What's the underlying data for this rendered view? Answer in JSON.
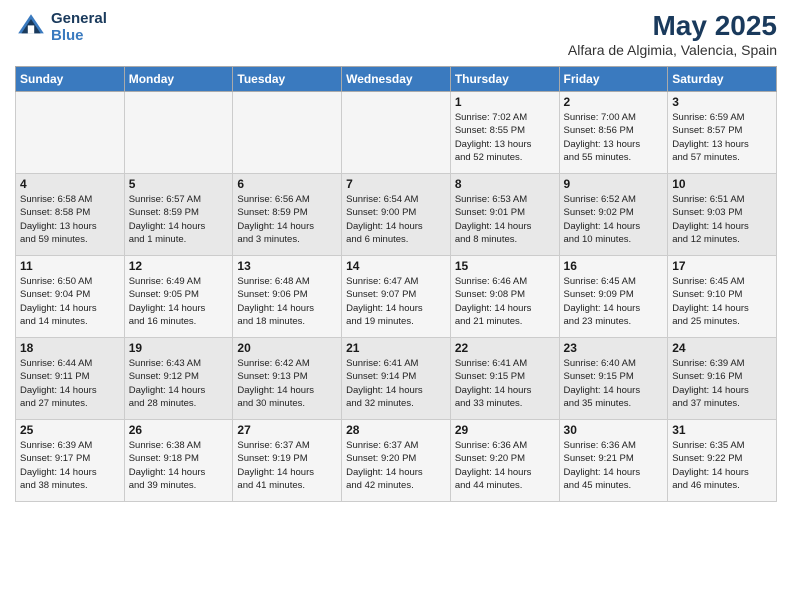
{
  "logo": {
    "line1": "General",
    "line2": "Blue"
  },
  "title": "May 2025",
  "subtitle": "Alfara de Algimia, Valencia, Spain",
  "headers": [
    "Sunday",
    "Monday",
    "Tuesday",
    "Wednesday",
    "Thursday",
    "Friday",
    "Saturday"
  ],
  "rows": [
    [
      {
        "day": "",
        "info": ""
      },
      {
        "day": "",
        "info": ""
      },
      {
        "day": "",
        "info": ""
      },
      {
        "day": "",
        "info": ""
      },
      {
        "day": "1",
        "info": "Sunrise: 7:02 AM\nSunset: 8:55 PM\nDaylight: 13 hours\nand 52 minutes."
      },
      {
        "day": "2",
        "info": "Sunrise: 7:00 AM\nSunset: 8:56 PM\nDaylight: 13 hours\nand 55 minutes."
      },
      {
        "day": "3",
        "info": "Sunrise: 6:59 AM\nSunset: 8:57 PM\nDaylight: 13 hours\nand 57 minutes."
      }
    ],
    [
      {
        "day": "4",
        "info": "Sunrise: 6:58 AM\nSunset: 8:58 PM\nDaylight: 13 hours\nand 59 minutes."
      },
      {
        "day": "5",
        "info": "Sunrise: 6:57 AM\nSunset: 8:59 PM\nDaylight: 14 hours\nand 1 minute."
      },
      {
        "day": "6",
        "info": "Sunrise: 6:56 AM\nSunset: 8:59 PM\nDaylight: 14 hours\nand 3 minutes."
      },
      {
        "day": "7",
        "info": "Sunrise: 6:54 AM\nSunset: 9:00 PM\nDaylight: 14 hours\nand 6 minutes."
      },
      {
        "day": "8",
        "info": "Sunrise: 6:53 AM\nSunset: 9:01 PM\nDaylight: 14 hours\nand 8 minutes."
      },
      {
        "day": "9",
        "info": "Sunrise: 6:52 AM\nSunset: 9:02 PM\nDaylight: 14 hours\nand 10 minutes."
      },
      {
        "day": "10",
        "info": "Sunrise: 6:51 AM\nSunset: 9:03 PM\nDaylight: 14 hours\nand 12 minutes."
      }
    ],
    [
      {
        "day": "11",
        "info": "Sunrise: 6:50 AM\nSunset: 9:04 PM\nDaylight: 14 hours\nand 14 minutes."
      },
      {
        "day": "12",
        "info": "Sunrise: 6:49 AM\nSunset: 9:05 PM\nDaylight: 14 hours\nand 16 minutes."
      },
      {
        "day": "13",
        "info": "Sunrise: 6:48 AM\nSunset: 9:06 PM\nDaylight: 14 hours\nand 18 minutes."
      },
      {
        "day": "14",
        "info": "Sunrise: 6:47 AM\nSunset: 9:07 PM\nDaylight: 14 hours\nand 19 minutes."
      },
      {
        "day": "15",
        "info": "Sunrise: 6:46 AM\nSunset: 9:08 PM\nDaylight: 14 hours\nand 21 minutes."
      },
      {
        "day": "16",
        "info": "Sunrise: 6:45 AM\nSunset: 9:09 PM\nDaylight: 14 hours\nand 23 minutes."
      },
      {
        "day": "17",
        "info": "Sunrise: 6:45 AM\nSunset: 9:10 PM\nDaylight: 14 hours\nand 25 minutes."
      }
    ],
    [
      {
        "day": "18",
        "info": "Sunrise: 6:44 AM\nSunset: 9:11 PM\nDaylight: 14 hours\nand 27 minutes."
      },
      {
        "day": "19",
        "info": "Sunrise: 6:43 AM\nSunset: 9:12 PM\nDaylight: 14 hours\nand 28 minutes."
      },
      {
        "day": "20",
        "info": "Sunrise: 6:42 AM\nSunset: 9:13 PM\nDaylight: 14 hours\nand 30 minutes."
      },
      {
        "day": "21",
        "info": "Sunrise: 6:41 AM\nSunset: 9:14 PM\nDaylight: 14 hours\nand 32 minutes."
      },
      {
        "day": "22",
        "info": "Sunrise: 6:41 AM\nSunset: 9:15 PM\nDaylight: 14 hours\nand 33 minutes."
      },
      {
        "day": "23",
        "info": "Sunrise: 6:40 AM\nSunset: 9:15 PM\nDaylight: 14 hours\nand 35 minutes."
      },
      {
        "day": "24",
        "info": "Sunrise: 6:39 AM\nSunset: 9:16 PM\nDaylight: 14 hours\nand 37 minutes."
      }
    ],
    [
      {
        "day": "25",
        "info": "Sunrise: 6:39 AM\nSunset: 9:17 PM\nDaylight: 14 hours\nand 38 minutes."
      },
      {
        "day": "26",
        "info": "Sunrise: 6:38 AM\nSunset: 9:18 PM\nDaylight: 14 hours\nand 39 minutes."
      },
      {
        "day": "27",
        "info": "Sunrise: 6:37 AM\nSunset: 9:19 PM\nDaylight: 14 hours\nand 41 minutes."
      },
      {
        "day": "28",
        "info": "Sunrise: 6:37 AM\nSunset: 9:20 PM\nDaylight: 14 hours\nand 42 minutes."
      },
      {
        "day": "29",
        "info": "Sunrise: 6:36 AM\nSunset: 9:20 PM\nDaylight: 14 hours\nand 44 minutes."
      },
      {
        "day": "30",
        "info": "Sunrise: 6:36 AM\nSunset: 9:21 PM\nDaylight: 14 hours\nand 45 minutes."
      },
      {
        "day": "31",
        "info": "Sunrise: 6:35 AM\nSunset: 9:22 PM\nDaylight: 14 hours\nand 46 minutes."
      }
    ]
  ]
}
